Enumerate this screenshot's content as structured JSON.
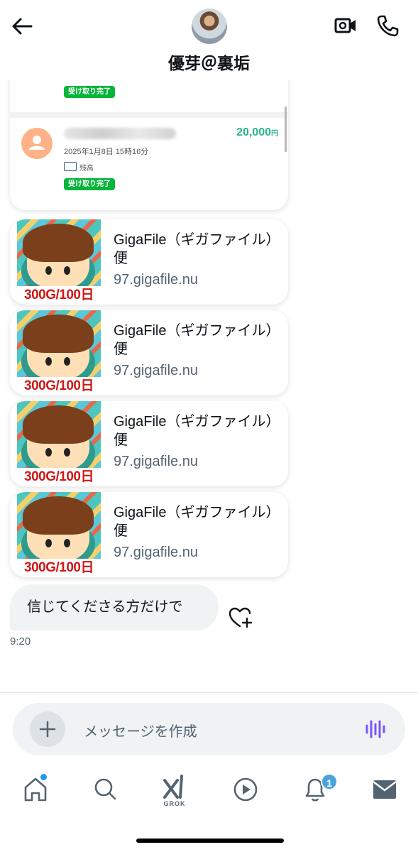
{
  "header": {
    "title": "優芽＠裏垢",
    "back_icon": "arrow-left-icon",
    "video_icon": "video-call-icon",
    "phone_icon": "phone-icon"
  },
  "payment_card": {
    "first_badge": "受け取り完了",
    "amount": "20,000",
    "currency": "円",
    "date": "2025年1月8日 15時16分",
    "balance_label": "残高",
    "second_badge": "受け取り完了"
  },
  "link_cards": [
    {
      "title": "GigaFile（ギガファイル）便",
      "domain": "97.gigafile.nu",
      "thumb_label": "300G/100日"
    },
    {
      "title": "GigaFile（ギガファイル）便",
      "domain": "97.gigafile.nu",
      "thumb_label": "300G/100日"
    },
    {
      "title": "GigaFile（ギガファイル）便",
      "domain": "97.gigafile.nu",
      "thumb_label": "300G/100日"
    },
    {
      "title": "GigaFile（ギガファイル）便",
      "domain": "97.gigafile.nu",
      "thumb_label": "300G/100日"
    }
  ],
  "message": {
    "text": "信じてくださる方だけで",
    "time": "9:20"
  },
  "composer": {
    "placeholder": "メッセージを作成"
  },
  "nav": {
    "grok_label": "GROK",
    "notification_count": "1"
  },
  "colors": {
    "accent_green": "#07b53b",
    "amount_green": "#2fb38b",
    "link_domain": "#536471",
    "voice_purple": "#7856ff",
    "badge_blue": "#1d9bf0"
  }
}
